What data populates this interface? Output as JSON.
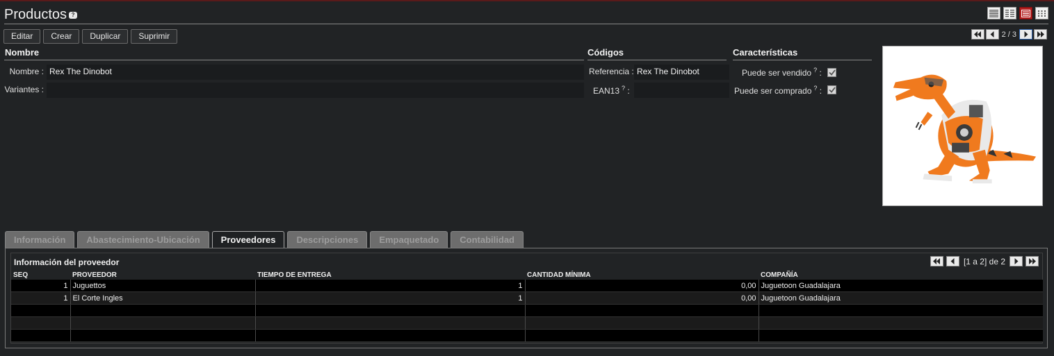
{
  "header": {
    "title": "Productos",
    "help_badge": "?",
    "view_icons": [
      "list-view-icon",
      "compact-list-view-icon",
      "form-view-icon",
      "grid-view-icon"
    ],
    "accent_color": "#b41e1e"
  },
  "toolbar": {
    "edit_label": "Editar",
    "create_label": "Crear",
    "duplicate_label": "Duplicar",
    "delete_label": "Suprimir"
  },
  "pager": {
    "count": "2 / 3"
  },
  "sections": {
    "name_title": "Nombre",
    "codes_title": "Códigos",
    "features_title": "Características"
  },
  "form": {
    "name_label": "Nombre :",
    "name_value": "Rex The Dinobot",
    "variants_label": "Variantes :",
    "variants_value": "",
    "reference_label": "Referencia :",
    "reference_value": "Rex The Dinobot",
    "ean13_label": "EAN13",
    "ean13_value": "",
    "help_mark": "?",
    "colon": ":",
    "can_be_sold_label": "Puede ser vendido",
    "can_be_sold": true,
    "can_be_purchased_label": "Puede ser comprado",
    "can_be_purchased": true
  },
  "tabs": [
    {
      "label": "Información",
      "active": false
    },
    {
      "label": "Abastecimiento-Ubicación",
      "active": false
    },
    {
      "label": "Proveedores",
      "active": true
    },
    {
      "label": "Descripciones",
      "active": false
    },
    {
      "label": "Empaquetado",
      "active": false
    },
    {
      "label": "Contabilidad",
      "active": false
    }
  ],
  "suppliers": {
    "title": "Información del proveedor",
    "pager_text": "[1 a 2] de 2",
    "columns": [
      "SEQ",
      "PROVEEDOR",
      "TIEMPO DE ENTREGA",
      "CANTIDAD MÍNIMA",
      "COMPAÑÍA"
    ],
    "rows": [
      {
        "seq": "1",
        "supplier": "Juguettos",
        "lead_time": "1",
        "min_qty": "0,00",
        "company": "Juguetoon Guadalajara"
      },
      {
        "seq": "1",
        "supplier": "El Corte Ingles",
        "lead_time": "1",
        "min_qty": "0,00",
        "company": "Juguetoon Guadalajara"
      }
    ]
  }
}
